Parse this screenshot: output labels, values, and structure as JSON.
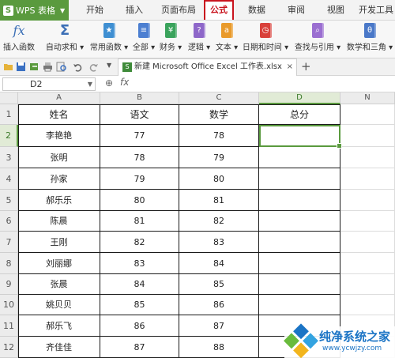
{
  "app": {
    "name": "WPS 表格",
    "badge": "S"
  },
  "tabs": [
    {
      "label": "开始",
      "active": false
    },
    {
      "label": "插入",
      "active": false
    },
    {
      "label": "页面布局",
      "active": false
    },
    {
      "label": "公式",
      "active": true
    },
    {
      "label": "数据",
      "active": false
    },
    {
      "label": "审阅",
      "active": false
    },
    {
      "label": "视图",
      "active": false
    },
    {
      "label": "开发工具",
      "active": false
    }
  ],
  "ribbon": [
    {
      "label": "插入函数",
      "icon": "fx-icon",
      "glyph": "fx"
    },
    {
      "label": "自动求和",
      "icon": "sigma-icon",
      "glyph": "Σ",
      "dropdown": true
    },
    {
      "label": "常用函数",
      "icon": "star-book-icon",
      "glyph": "★",
      "dropdown": true,
      "color": "#3f8fd2"
    },
    {
      "label": "全部",
      "icon": "list-book-icon",
      "glyph": "≡",
      "dropdown": true,
      "color": "#4c7fd1"
    },
    {
      "label": "财务",
      "icon": "finance-book-icon",
      "glyph": "¥",
      "dropdown": true,
      "color": "#3aa35c"
    },
    {
      "label": "逻辑",
      "icon": "logic-book-icon",
      "glyph": "?",
      "dropdown": true,
      "color": "#8e67c9"
    },
    {
      "label": "文本",
      "icon": "text-book-icon",
      "glyph": "a",
      "dropdown": true,
      "color": "#e99a2a"
    },
    {
      "label": "日期和时间",
      "icon": "clock-book-icon",
      "glyph": "◷",
      "dropdown": true,
      "color": "#d9413b"
    },
    {
      "label": "查找与引用",
      "icon": "search-book-icon",
      "glyph": "⌕",
      "dropdown": true,
      "color": "#9b6fd1"
    },
    {
      "label": "数学和三角",
      "icon": "theta-book-icon",
      "glyph": "θ",
      "dropdown": true,
      "color": "#4a78c8"
    }
  ],
  "document": {
    "tab_title": "新建 Microsoft Office Excel 工作表.xlsx",
    "close": "×",
    "new_tab": "+"
  },
  "formula_bar": {
    "cell_ref": "D2",
    "fx": "fx",
    "value": ""
  },
  "columns": [
    "A",
    "B",
    "C",
    "D",
    "N"
  ],
  "rows": [
    "1",
    "2",
    "3",
    "4",
    "5",
    "6",
    "7",
    "8",
    "9",
    "10",
    "11",
    "12"
  ],
  "table": {
    "headers": [
      "姓名",
      "语文",
      "数学",
      "总分"
    ],
    "data": [
      [
        "李艳艳",
        "77",
        "78",
        ""
      ],
      [
        "张明",
        "78",
        "79",
        ""
      ],
      [
        "孙家",
        "79",
        "80",
        ""
      ],
      [
        "郝乐乐",
        "80",
        "81",
        ""
      ],
      [
        "陈晨",
        "81",
        "82",
        ""
      ],
      [
        "王刚",
        "82",
        "83",
        ""
      ],
      [
        "刘丽娜",
        "83",
        "84",
        ""
      ],
      [
        "张晨",
        "84",
        "85",
        ""
      ],
      [
        "姚贝贝",
        "85",
        "86",
        ""
      ],
      [
        "郝乐飞",
        "86",
        "87",
        ""
      ],
      [
        "齐佳佳",
        "87",
        "88",
        ""
      ]
    ]
  },
  "selected_cell": "D2",
  "watermark": {
    "title": "纯净系统之家",
    "url": "www.ycwjzy.com"
  },
  "colors": {
    "accent": "#5a9a3e",
    "active_tab": "#c9141e"
  }
}
